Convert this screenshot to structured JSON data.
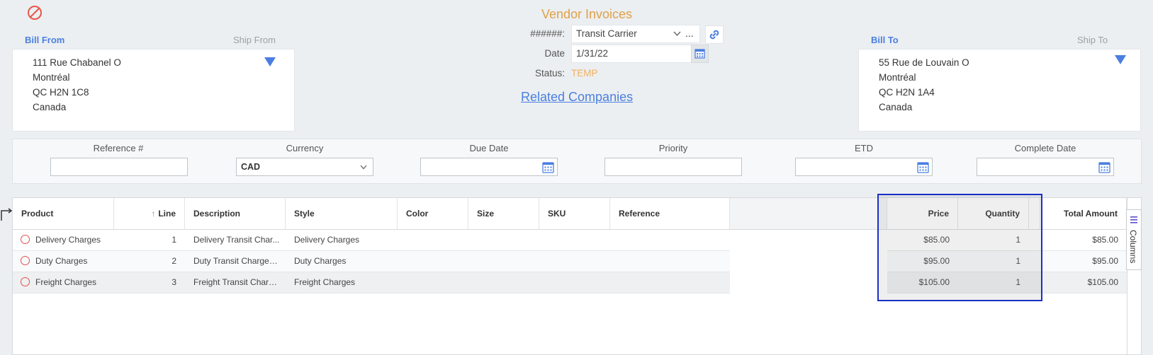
{
  "title": "Vendor Invoices",
  "bill_from": {
    "label": "Bill From",
    "ship_label": "Ship From",
    "lines": [
      "111 Rue Chabanel O",
      "Montréal",
      "QC H2N 1C8",
      "Canada"
    ]
  },
  "bill_to": {
    "label": "Bill To",
    "ship_label": "Ship To",
    "lines": [
      "55 Rue de Louvain O",
      "Montréal",
      "QC H2N 1A4",
      "Canada"
    ]
  },
  "header": {
    "number_label": "######:",
    "carrier": "Transit Carrier",
    "more": "...",
    "date_label": "Date",
    "date_value": "1/31/22",
    "status_label": "Status:",
    "status_value": "TEMP",
    "related_link": "Related Companies"
  },
  "filters": {
    "reference_label": "Reference #",
    "currency_label": "Currency",
    "currency_value": "CAD",
    "due_date_label": "Due Date",
    "priority_label": "Priority",
    "etd_label": "ETD",
    "complete_date_label": "Complete Date"
  },
  "grid": {
    "columns": {
      "product": "Product",
      "line": "Line",
      "description": "Description",
      "style": "Style",
      "color": "Color",
      "size": "Size",
      "sku": "SKU",
      "reference": "Reference",
      "price": "Price",
      "quantity": "Quantity",
      "total": "Total Amount"
    },
    "columns_tab": "Columns",
    "rows": [
      {
        "product": "Delivery Charges",
        "line": "1",
        "description": "Delivery Transit Char...",
        "style": "Delivery Charges",
        "price": "$85.00",
        "quantity": "1",
        "total": "$85.00"
      },
      {
        "product": "Duty Charges",
        "line": "2",
        "description": "Duty Transit Charge i...",
        "style": "Duty Charges",
        "price": "$95.00",
        "quantity": "1",
        "total": "$95.00"
      },
      {
        "product": "Freight Charges",
        "line": "3",
        "description": "Freight Transit Charg...",
        "style": "Freight Charges",
        "price": "$105.00",
        "quantity": "1",
        "total": "$105.00"
      }
    ]
  },
  "colors": {
    "accent": "#4a7fe0",
    "title": "#e0a04a",
    "status": "#f0b060",
    "selection": "#1a2fc8",
    "remove": "#e05050"
  }
}
